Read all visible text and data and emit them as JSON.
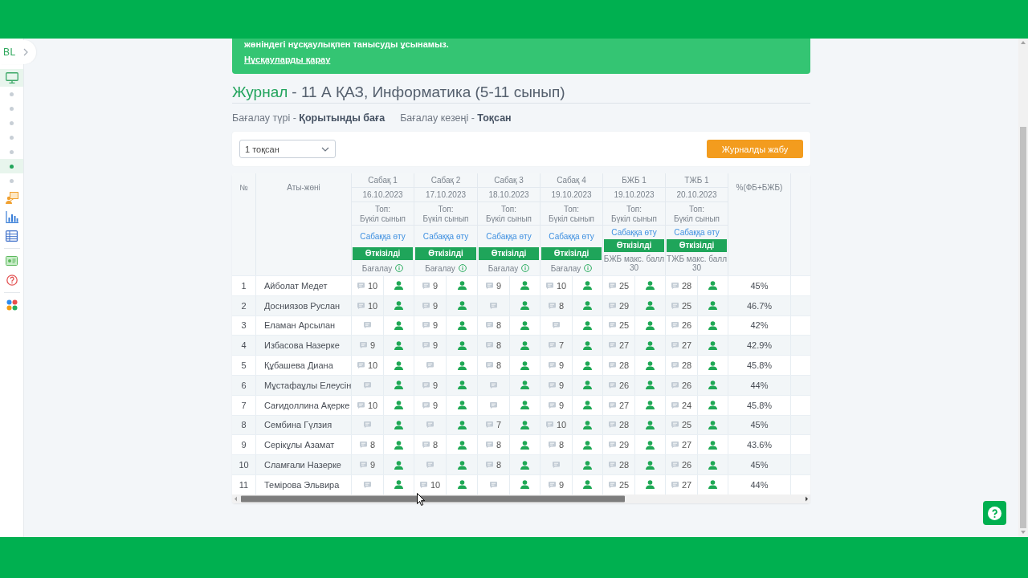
{
  "banner": {
    "text": "жөніндегі нұсқаулықпен танысуды ұсынамыз.",
    "link": "Нұсқауларды қарау"
  },
  "sidebar": {
    "logo": "BL",
    "items": [
      {
        "kind": "icon",
        "selected": true
      },
      {
        "kind": "dot",
        "selected": false
      },
      {
        "kind": "dot",
        "selected": false
      },
      {
        "kind": "dot",
        "selected": false
      },
      {
        "kind": "dot",
        "selected": false
      },
      {
        "kind": "dot",
        "selected": false
      },
      {
        "kind": "dot",
        "selected": true
      },
      {
        "kind": "dot",
        "selected": false
      },
      {
        "kind": "icon",
        "selected": false
      },
      {
        "kind": "icon",
        "selected": false
      },
      {
        "kind": "icon",
        "selected": false
      },
      {
        "kind": "divider"
      },
      {
        "kind": "icon",
        "selected": false
      },
      {
        "kind": "icon",
        "selected": false
      },
      {
        "kind": "divider"
      },
      {
        "kind": "icon",
        "selected": false
      }
    ]
  },
  "heading": {
    "section": "Журнал",
    "title": "- 11 А ҚАЗ, Информатика (5-11 сынып)"
  },
  "filters": [
    "Бағалау түрі - **Қорытынды баға**",
    "Бағалау кезеңі - **Тоқсан**"
  ],
  "toolbar": {
    "period_select": {
      "value": "1 тоқсан"
    },
    "close_button": "Журналды жабу"
  },
  "table": {
    "columns": {
      "index": "№",
      "name": "Аты-жөні",
      "percent": "%(ФБ+БЖБ)"
    },
    "lessons": [
      {
        "kind": "lesson",
        "title": "Сабақ 1",
        "date": "16.10.2023",
        "group_label": "Топ:",
        "group": "Бүкіл сынып",
        "link": "Сабаққа өту",
        "status": "Өткізілді",
        "footer": "Бағалау"
      },
      {
        "kind": "lesson",
        "title": "Сабақ 2",
        "date": "17.10.2023",
        "group_label": "Топ:",
        "group": "Бүкіл сынып",
        "link": "Сабаққа өту",
        "status": "Өткізілді",
        "footer": "Бағалау"
      },
      {
        "kind": "lesson",
        "title": "Сабақ 3",
        "date": "18.10.2023",
        "group_label": "Топ:",
        "group": "Бүкіл сынып",
        "link": "Сабаққа өту",
        "status": "Өткізілді",
        "footer": "Бағалау"
      },
      {
        "kind": "lesson",
        "title": "Сабақ 4",
        "date": "19.10.2023",
        "group_label": "Топ:",
        "group": "Бүкіл сынып",
        "link": "Сабаққа өту",
        "status": "Өткізілді",
        "footer": "Бағалау"
      },
      {
        "kind": "assessment",
        "title": "БЖБ 1",
        "date": "19.10.2023",
        "group_label": "Топ:",
        "group": "Бүкіл сынып",
        "link": "Сабаққа өту",
        "status": "Өткізілді",
        "footer": "БЖБ макс. балл",
        "max_score": "30"
      },
      {
        "kind": "assessment",
        "title": "ТЖБ 1",
        "date": "20.10.2023",
        "group_label": "Топ:",
        "group": "Бүкіл сынып",
        "link": "Сабаққа өту",
        "status": "Өткізілді",
        "footer": "ТЖБ макс. балл",
        "max_score": "30"
      }
    ],
    "rows": [
      {
        "index": "1",
        "name": "Айболат Медет",
        "cells": [
          {
            "kind": "graded",
            "value": "10"
          },
          {
            "kind": "graded",
            "value": "9"
          },
          {
            "kind": "graded",
            "value": "9"
          },
          {
            "kind": "graded",
            "value": "10"
          },
          {
            "kind": "graded",
            "value": "25"
          },
          {
            "kind": "graded",
            "value": "28"
          }
        ],
        "percent": "45%"
      },
      {
        "index": "2",
        "name": "Досниязов Руслан",
        "cells": [
          {
            "kind": "graded",
            "value": "10"
          },
          {
            "kind": "graded",
            "value": "9"
          },
          {
            "kind": "empty"
          },
          {
            "kind": "graded",
            "value": "8"
          },
          {
            "kind": "graded",
            "value": "29"
          },
          {
            "kind": "graded",
            "value": "25"
          }
        ],
        "percent": "46.7%"
      },
      {
        "index": "3",
        "name": "Еламан Арсылан",
        "cells": [
          {
            "kind": "empty"
          },
          {
            "kind": "graded",
            "value": "9"
          },
          {
            "kind": "graded",
            "value": "8"
          },
          {
            "kind": "empty"
          },
          {
            "kind": "graded",
            "value": "25"
          },
          {
            "kind": "graded",
            "value": "26"
          }
        ],
        "percent": "42%"
      },
      {
        "index": "4",
        "name": "Избасова Назерке",
        "cells": [
          {
            "kind": "graded",
            "value": "9"
          },
          {
            "kind": "graded",
            "value": "9"
          },
          {
            "kind": "graded",
            "value": "8"
          },
          {
            "kind": "graded",
            "value": "7"
          },
          {
            "kind": "graded",
            "value": "27"
          },
          {
            "kind": "graded",
            "value": "27"
          }
        ],
        "percent": "42.9%"
      },
      {
        "index": "5",
        "name": "Құбашева Диана",
        "cells": [
          {
            "kind": "graded",
            "value": "10"
          },
          {
            "kind": "empty"
          },
          {
            "kind": "graded",
            "value": "8"
          },
          {
            "kind": "graded",
            "value": "9"
          },
          {
            "kind": "graded",
            "value": "28"
          },
          {
            "kind": "graded",
            "value": "28"
          }
        ],
        "percent": "45.8%"
      },
      {
        "index": "6",
        "name": "Мұстафаұлы Елеусін",
        "cells": [
          {
            "kind": "empty"
          },
          {
            "kind": "graded",
            "value": "9"
          },
          {
            "kind": "empty"
          },
          {
            "kind": "graded",
            "value": "9"
          },
          {
            "kind": "graded",
            "value": "26"
          },
          {
            "kind": "graded",
            "value": "26"
          }
        ],
        "percent": "44%"
      },
      {
        "index": "7",
        "name": "Сағидоллина Ақерке",
        "cells": [
          {
            "kind": "graded",
            "value": "10"
          },
          {
            "kind": "graded",
            "value": "9"
          },
          {
            "kind": "empty"
          },
          {
            "kind": "graded",
            "value": "9"
          },
          {
            "kind": "graded",
            "value": "27"
          },
          {
            "kind": "graded",
            "value": "24"
          }
        ],
        "percent": "45.8%"
      },
      {
        "index": "8",
        "name": "Сембина Гүлзия",
        "cells": [
          {
            "kind": "empty"
          },
          {
            "kind": "empty"
          },
          {
            "kind": "graded",
            "value": "7"
          },
          {
            "kind": "graded",
            "value": "10"
          },
          {
            "kind": "graded",
            "value": "28"
          },
          {
            "kind": "graded",
            "value": "25"
          }
        ],
        "percent": "45%"
      },
      {
        "index": "9",
        "name": "Серікұлы Азамат",
        "cells": [
          {
            "kind": "graded",
            "value": "8"
          },
          {
            "kind": "graded",
            "value": "8"
          },
          {
            "kind": "graded",
            "value": "8"
          },
          {
            "kind": "graded",
            "value": "8"
          },
          {
            "kind": "graded",
            "value": "29"
          },
          {
            "kind": "graded",
            "value": "27"
          }
        ],
        "percent": "43.6%"
      },
      {
        "index": "10",
        "name": "Сламғали Назерке",
        "cells": [
          {
            "kind": "graded",
            "value": "9"
          },
          {
            "kind": "empty"
          },
          {
            "kind": "graded",
            "value": "8"
          },
          {
            "kind": "empty"
          },
          {
            "kind": "graded",
            "value": "28"
          },
          {
            "kind": "graded",
            "value": "26"
          }
        ],
        "percent": "45%"
      },
      {
        "index": "11",
        "name": "Темірова Эльвира",
        "cells": [
          {
            "kind": "empty"
          },
          {
            "kind": "graded",
            "value": "10"
          },
          {
            "kind": "empty"
          },
          {
            "kind": "graded",
            "value": "9"
          },
          {
            "kind": "graded",
            "value": "25"
          },
          {
            "kind": "graded",
            "value": "27"
          }
        ],
        "percent": "44%"
      }
    ]
  }
}
